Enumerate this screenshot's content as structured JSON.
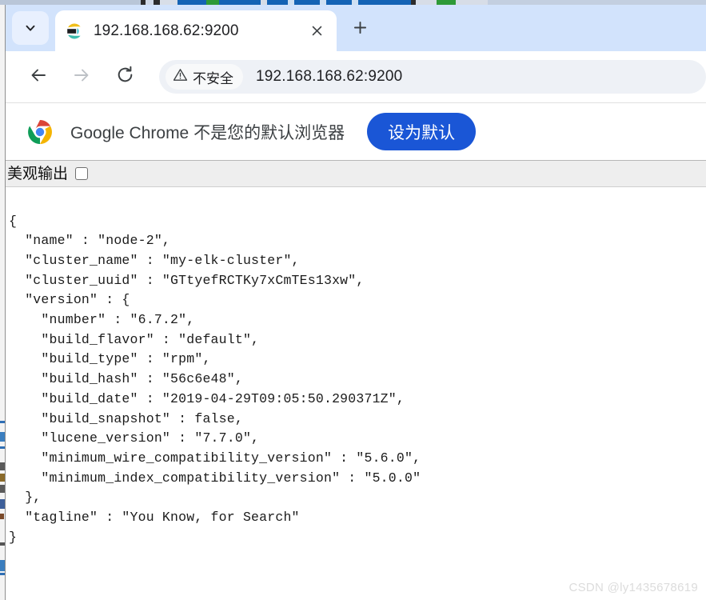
{
  "window": {
    "tab_strip": {
      "tab_search_icon": "chevron-down-icon",
      "new_tab_icon": "plus-icon",
      "tabs": [
        {
          "title": "192.168.168.62:9200",
          "favicon": "elasticsearch-icon",
          "close_icon": "close-icon",
          "active": true
        }
      ]
    },
    "toolbar": {
      "back_icon": "arrow-left-icon",
      "forward_icon": "arrow-right-icon",
      "reload_icon": "reload-icon",
      "security_icon": "warning-triangle-icon",
      "security_label": "不安全",
      "url": "192.168.168.62:9200"
    },
    "infobar": {
      "logo_icon": "chrome-logo-icon",
      "message": "Google Chrome 不是您的默认浏览器",
      "button_label": "设为默认",
      "button_color": "#1a56d6"
    }
  },
  "page": {
    "pretty_print_label": "美观输出",
    "pretty_print_checked": false,
    "json_text": "{\n  \"name\" : \"node-2\",\n  \"cluster_name\" : \"my-elk-cluster\",\n  \"cluster_uuid\" : \"GTtyefRCTKy7xCmTEs13xw\",\n  \"version\" : {\n    \"number\" : \"6.7.2\",\n    \"build_flavor\" : \"default\",\n    \"build_type\" : \"rpm\",\n    \"build_hash\" : \"56c6e48\",\n    \"build_date\" : \"2019-04-29T09:05:50.290371Z\",\n    \"build_snapshot\" : false,\n    \"lucene_version\" : \"7.7.0\",\n    \"minimum_wire_compatibility_version\" : \"5.6.0\",\n    \"minimum_index_compatibility_version\" : \"5.0.0\"\n  },\n  \"tagline\" : \"You Know, for Search\"\n}",
    "response": {
      "name": "node-2",
      "cluster_name": "my-elk-cluster",
      "cluster_uuid": "GTtyefRCTKy7xCmTEs13xw",
      "version": {
        "number": "6.7.2",
        "build_flavor": "default",
        "build_type": "rpm",
        "build_hash": "56c6e48",
        "build_date": "2019-04-29T09:05:50.290371Z",
        "build_snapshot": "false",
        "lucene_version": "7.7.0",
        "minimum_wire_compatibility_version": "5.6.0",
        "minimum_index_compatibility_version": "5.0.0"
      },
      "tagline": "You Know, for Search"
    }
  },
  "watermark": "CSDN @ly1435678619"
}
